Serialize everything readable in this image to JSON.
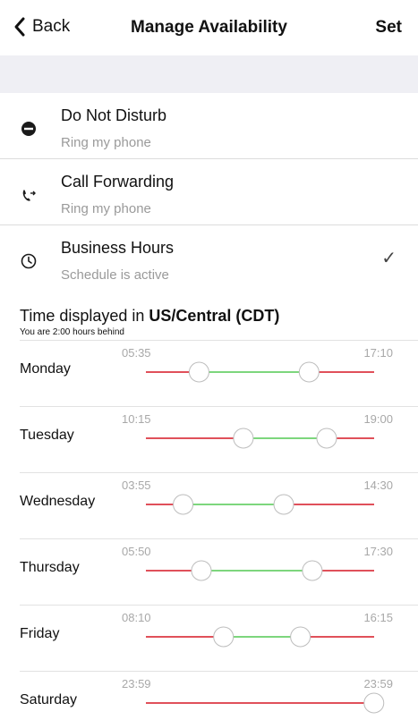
{
  "navbar": {
    "back_label": "Back",
    "title": "Manage Availability",
    "set_label": "Set"
  },
  "options": [
    {
      "title": "Do Not Disturb",
      "subtitle": "Ring my phone",
      "icon": "minus-circle-icon",
      "checked": false
    },
    {
      "title": "Call Forwarding",
      "subtitle": "Ring my phone",
      "icon": "phone-forward-icon",
      "checked": false
    },
    {
      "title": "Business Hours",
      "subtitle": "Schedule is active",
      "icon": "clock-icon",
      "checked": true
    }
  ],
  "timezone": {
    "prefix": "Time displayed in ",
    "zone": "US/Central (CDT)",
    "note": "You are 2:00 hours behind"
  },
  "colors": {
    "range_active": "#7dd67d",
    "range_inactive": "#e0505a",
    "separator": "#dcdcdc",
    "band": "#efeff4"
  },
  "schedule": [
    {
      "day": "Monday",
      "start": "05:35",
      "end": "17:10",
      "start_frac": 0.233,
      "end_frac": 0.715
    },
    {
      "day": "Tuesday",
      "start": "10:15",
      "end": "19:00",
      "start_frac": 0.427,
      "end_frac": 0.792
    },
    {
      "day": "Wednesday",
      "start": "03:55",
      "end": "14:30",
      "start_frac": 0.163,
      "end_frac": 0.604
    },
    {
      "day": "Thursday",
      "start": "05:50",
      "end": "17:30",
      "start_frac": 0.243,
      "end_frac": 0.729
    },
    {
      "day": "Friday",
      "start": "08:10",
      "end": "16:15",
      "start_frac": 0.34,
      "end_frac": 0.677
    },
    {
      "day": "Saturday",
      "start": "23:59",
      "end": "23:59",
      "start_frac": 0.999,
      "end_frac": 0.999
    }
  ]
}
